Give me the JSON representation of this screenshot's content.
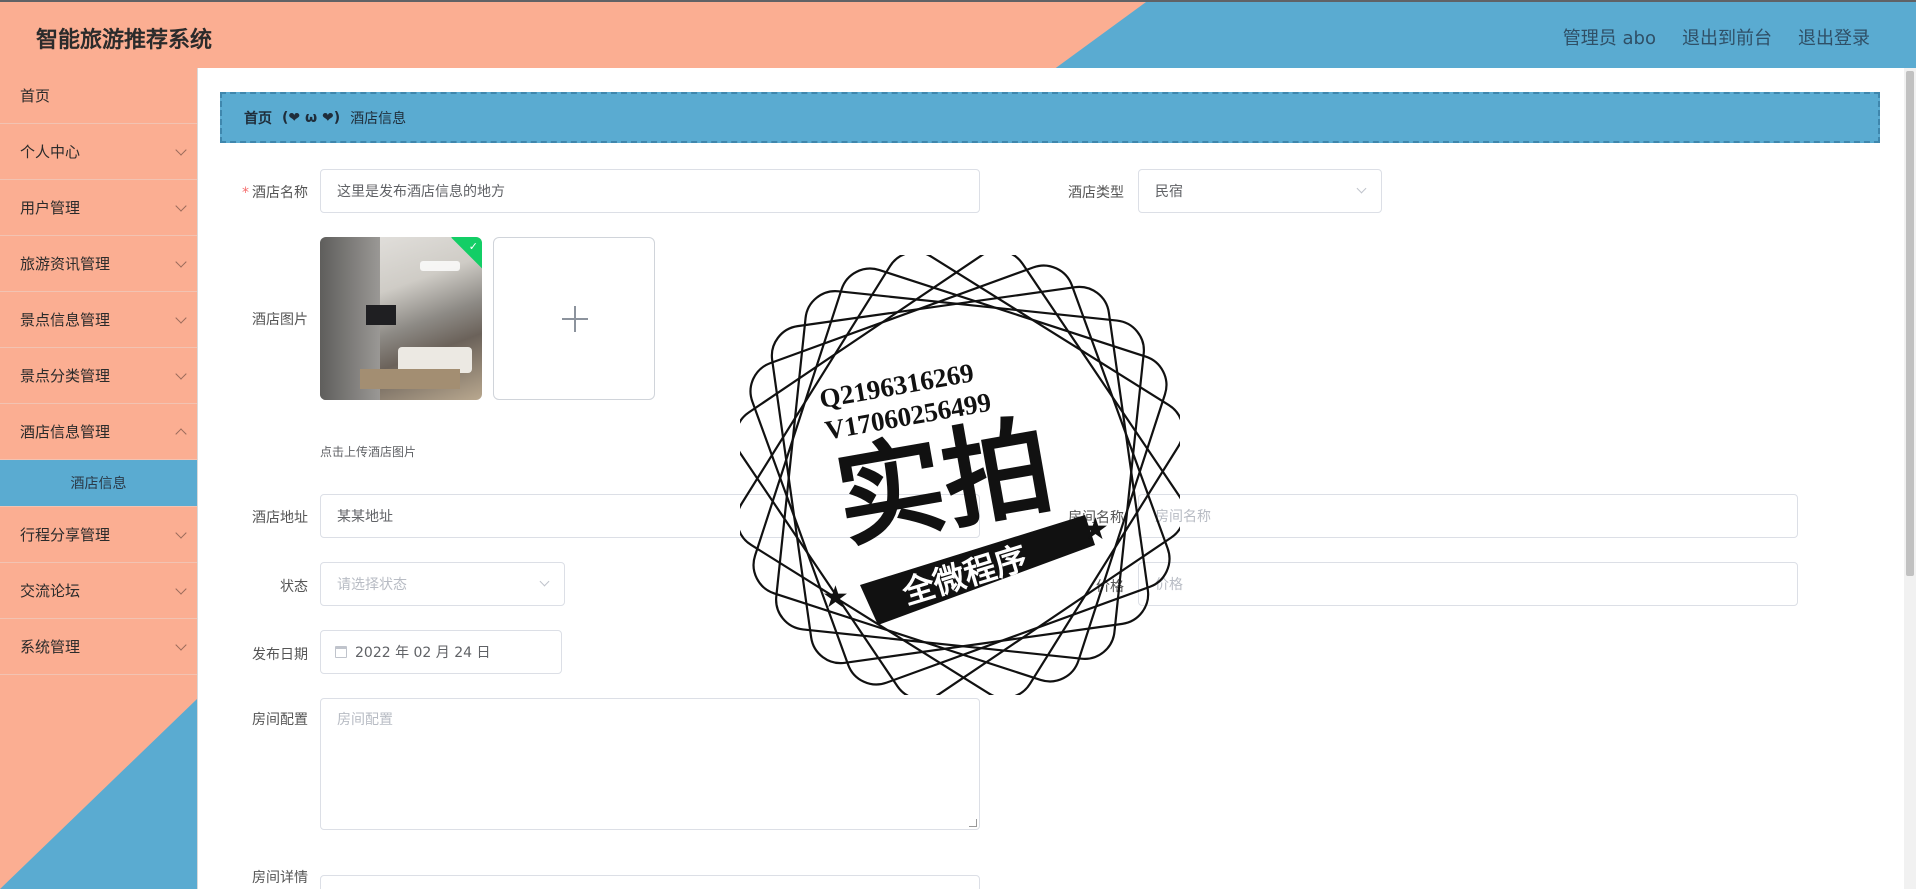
{
  "header": {
    "app_title": "智能旅游推荐系统",
    "user": "管理员 abo",
    "to_front": "退出到前台",
    "logout": "退出登录"
  },
  "sidebar": {
    "items": [
      {
        "label": "首页"
      },
      {
        "label": "个人中心"
      },
      {
        "label": "用户管理"
      },
      {
        "label": "旅游资讯管理"
      },
      {
        "label": "景点信息管理"
      },
      {
        "label": "景点分类管理"
      },
      {
        "label": "酒店信息管理"
      },
      {
        "label": "酒店信息"
      },
      {
        "label": "行程分享管理"
      },
      {
        "label": "交流论坛"
      },
      {
        "label": "系统管理"
      }
    ]
  },
  "breadcrumb": {
    "home": "首页",
    "separator": "(❤ ω ❤)",
    "current": "酒店信息"
  },
  "form": {
    "hotel_name": {
      "label": "酒店名称",
      "required": "*",
      "value": "这里是发布酒店信息的地方"
    },
    "hotel_type": {
      "label": "酒店类型",
      "value": "民宿"
    },
    "hotel_image": {
      "label": "酒店图片",
      "tip": "点击上传酒店图片"
    },
    "hotel_address": {
      "label": "酒店地址",
      "value": "某某地址"
    },
    "room_name": {
      "label": "房间名称",
      "placeholder": "房间名称"
    },
    "status": {
      "label": "状态",
      "placeholder": "请选择状态"
    },
    "price": {
      "label": "价格",
      "placeholder": "价格"
    },
    "publish_date": {
      "label": "发布日期",
      "value": "2022 年 02 月 24 日"
    },
    "room_config": {
      "label": "房间配置",
      "placeholder": "房间配置"
    },
    "room_detail": {
      "label": "房间详情"
    }
  },
  "watermark": {
    "line1": "Q2196316269",
    "line2": "V17060256499",
    "big_text": "实拍",
    "ribbon_text": "全微程序"
  },
  "colors": {
    "salmon": "#fbae92",
    "blue": "#5aabd1"
  }
}
